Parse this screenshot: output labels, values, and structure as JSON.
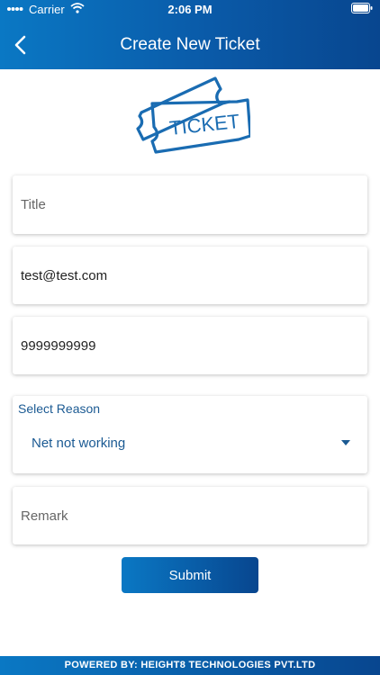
{
  "status_bar": {
    "carrier": "Carrier",
    "time": "2:06 PM",
    "battery_icon": "battery-icon",
    "wifi_icon": "wifi-icon"
  },
  "nav": {
    "title": "Create New Ticket",
    "back_icon": "chevron-left-icon"
  },
  "logo": {
    "text": "TICKET",
    "icon": "ticket-icon"
  },
  "form": {
    "title": {
      "placeholder": "Title",
      "value": ""
    },
    "email": {
      "value": "test@test.com"
    },
    "phone": {
      "value": "9999999999"
    },
    "reason": {
      "label": "Select Reason",
      "selected": "Net not working",
      "arrow_icon": "dropdown-arrow-icon"
    },
    "remark": {
      "placeholder": "Remark",
      "value": ""
    },
    "submit_label": "Submit"
  },
  "footer": {
    "text": "POWERED BY: HEIGHT8 TECHNOLOGIES PVT.LTD"
  },
  "colors": {
    "primary": "#0a5aa8",
    "accent": "#1b5a93"
  }
}
